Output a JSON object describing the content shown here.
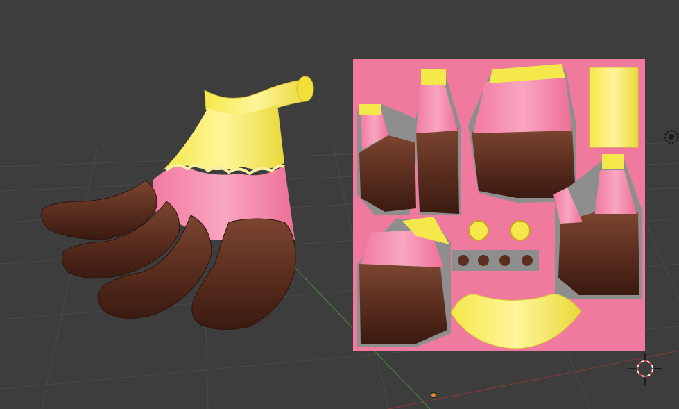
{
  "viewport": {
    "background": "#3d3d3d",
    "grid_color": "#4a4a4a",
    "axis_x_color": "#8a3a3a",
    "axis_y_color": "#4f8a3f"
  },
  "model": {
    "colors": {
      "brown": "#5b2e1f",
      "brown_dark": "#3a1a10",
      "brown_light": "#7b4530",
      "pink": "#f27aa0",
      "pink_light": "#f9a6c0",
      "yellow": "#f5e84a",
      "yellow_light": "#fff59a"
    }
  },
  "texture_preview": {
    "background": "#f07a9e",
    "shadow": "#8e8e8e"
  },
  "gizmos": {
    "cursor_icon": "3d-cursor-icon",
    "light_icon": "light-icon",
    "origin_icon": "origin-dot-icon"
  }
}
